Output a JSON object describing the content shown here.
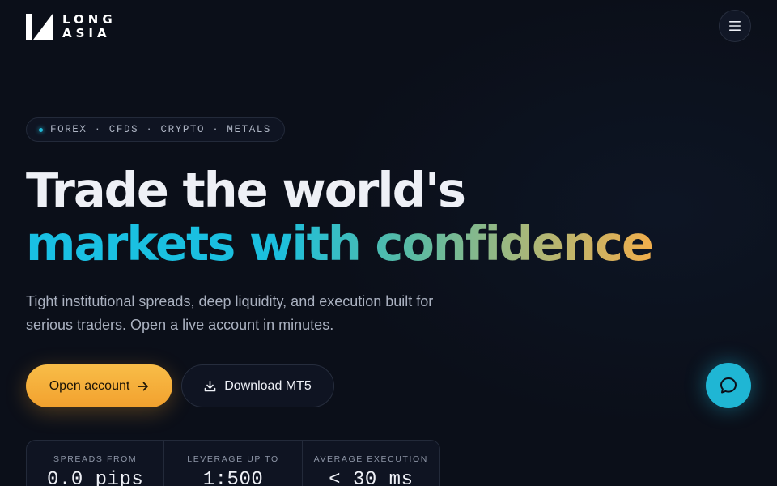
{
  "brand": {
    "line1": "LONG",
    "line2": "ASIA",
    "logo_icon": "long-asia-logo-mark"
  },
  "nav": {
    "menu_icon": "hamburger-menu-icon"
  },
  "hero": {
    "badge": "FOREX · CFDS · CRYPTO · METALS",
    "headline_line1": "Trade the world's",
    "headline_line2": "markets with confidence",
    "subtitle": "Tight institutional spreads, deep liquidity, and execution built for serious traders. Open a live account in minutes."
  },
  "actions": {
    "primary_label": "Open account",
    "primary_icon": "arrow-right-icon",
    "secondary_label": "Download MT5",
    "secondary_icon": "download-icon"
  },
  "chat": {
    "icon": "chat-bubble-icon"
  },
  "stats": [
    {
      "label": "SPREADS FROM",
      "value": "0.0 pips"
    },
    {
      "label": "LEVERAGE UP TO",
      "value": "1:500"
    },
    {
      "label": "AVERAGE EXECUTION",
      "value": "< 30 ms"
    }
  ],
  "colors": {
    "background": "#0b0f19",
    "accent_orange": "#f5ad3a",
    "accent_cyan": "#1fb6d4",
    "gradient_start": "#19c0e4",
    "gradient_end": "#f0ae4c"
  }
}
